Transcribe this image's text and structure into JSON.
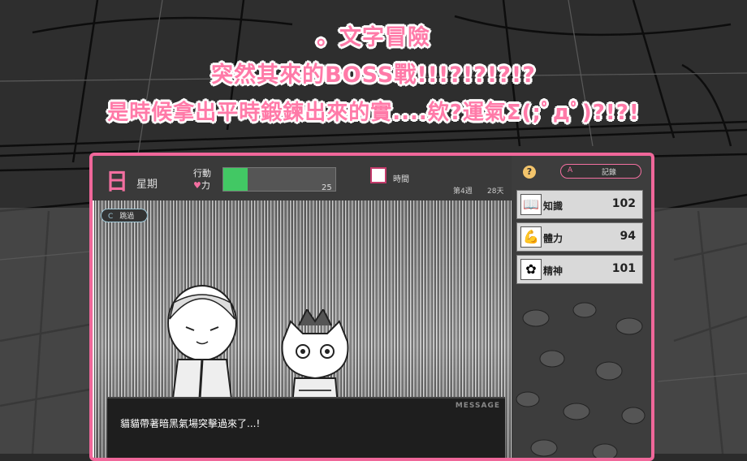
{
  "caption": {
    "line1": "。文字冒險",
    "line2": "突然其來的BOSS戰!!!?!?!?!?",
    "line3": "是時候拿出平時鍛鍊出來的實....欸?運氣Σ(;ﾟдﾟ)?!?!"
  },
  "hud": {
    "day_glyph": "日",
    "day_label": "星期",
    "action_label_1": "行動",
    "action_label_2": "力",
    "action_value": "25",
    "action_fill_percent": 22,
    "time_label": "時間",
    "week_label": "第4週",
    "days_count": "28天"
  },
  "scene": {
    "prompt_key": "C",
    "prompt_label": "跳過"
  },
  "message": {
    "tag": "MESSAGE",
    "text": "貓貓帶著暗黑氣場突擊過來了...!"
  },
  "side": {
    "info_icon": "?",
    "record_key": "A",
    "record_label": "記錄",
    "stats": [
      {
        "name": "知識",
        "value": "102",
        "icon": "book-icon"
      },
      {
        "name": "體力",
        "value": "94",
        "icon": "muscle-icon"
      },
      {
        "name": "精神",
        "value": "101",
        "icon": "spirit-icon"
      }
    ]
  },
  "colors": {
    "accent": "#f0679a",
    "action_bar": "#42c864",
    "caption_pink": "#ff7aa8"
  }
}
